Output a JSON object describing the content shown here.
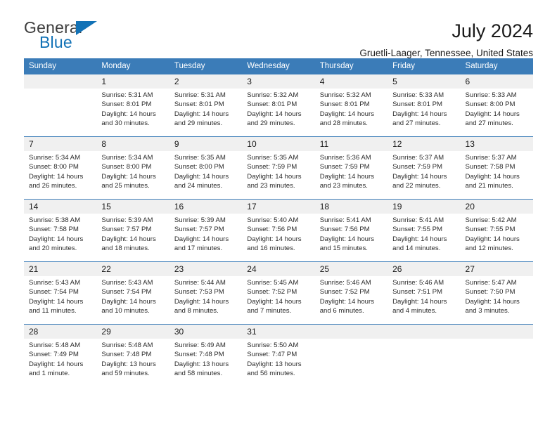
{
  "logo": {
    "word_one": "General",
    "word_two": "Blue",
    "triangle_icon": "triangle-icon",
    "accent_color": "#1272b6"
  },
  "header": {
    "title": "July 2024",
    "subtitle": "Gruetli-Laager, Tennessee, United States"
  },
  "calendar": {
    "header_color": "#3b7cb8",
    "daynum_band_color": "#f0f0f0",
    "weekdays": [
      "Sunday",
      "Monday",
      "Tuesday",
      "Wednesday",
      "Thursday",
      "Friday",
      "Saturday"
    ],
    "weeks": [
      [
        {
          "day": "",
          "lines": []
        },
        {
          "day": "1",
          "lines": [
            "Sunrise: 5:31 AM",
            "Sunset: 8:01 PM",
            "Daylight: 14 hours",
            "and 30 minutes."
          ]
        },
        {
          "day": "2",
          "lines": [
            "Sunrise: 5:31 AM",
            "Sunset: 8:01 PM",
            "Daylight: 14 hours",
            "and 29 minutes."
          ]
        },
        {
          "day": "3",
          "lines": [
            "Sunrise: 5:32 AM",
            "Sunset: 8:01 PM",
            "Daylight: 14 hours",
            "and 29 minutes."
          ]
        },
        {
          "day": "4",
          "lines": [
            "Sunrise: 5:32 AM",
            "Sunset: 8:01 PM",
            "Daylight: 14 hours",
            "and 28 minutes."
          ]
        },
        {
          "day": "5",
          "lines": [
            "Sunrise: 5:33 AM",
            "Sunset: 8:01 PM",
            "Daylight: 14 hours",
            "and 27 minutes."
          ]
        },
        {
          "day": "6",
          "lines": [
            "Sunrise: 5:33 AM",
            "Sunset: 8:00 PM",
            "Daylight: 14 hours",
            "and 27 minutes."
          ]
        }
      ],
      [
        {
          "day": "7",
          "lines": [
            "Sunrise: 5:34 AM",
            "Sunset: 8:00 PM",
            "Daylight: 14 hours",
            "and 26 minutes."
          ]
        },
        {
          "day": "8",
          "lines": [
            "Sunrise: 5:34 AM",
            "Sunset: 8:00 PM",
            "Daylight: 14 hours",
            "and 25 minutes."
          ]
        },
        {
          "day": "9",
          "lines": [
            "Sunrise: 5:35 AM",
            "Sunset: 8:00 PM",
            "Daylight: 14 hours",
            "and 24 minutes."
          ]
        },
        {
          "day": "10",
          "lines": [
            "Sunrise: 5:35 AM",
            "Sunset: 7:59 PM",
            "Daylight: 14 hours",
            "and 23 minutes."
          ]
        },
        {
          "day": "11",
          "lines": [
            "Sunrise: 5:36 AM",
            "Sunset: 7:59 PM",
            "Daylight: 14 hours",
            "and 23 minutes."
          ]
        },
        {
          "day": "12",
          "lines": [
            "Sunrise: 5:37 AM",
            "Sunset: 7:59 PM",
            "Daylight: 14 hours",
            "and 22 minutes."
          ]
        },
        {
          "day": "13",
          "lines": [
            "Sunrise: 5:37 AM",
            "Sunset: 7:58 PM",
            "Daylight: 14 hours",
            "and 21 minutes."
          ]
        }
      ],
      [
        {
          "day": "14",
          "lines": [
            "Sunrise: 5:38 AM",
            "Sunset: 7:58 PM",
            "Daylight: 14 hours",
            "and 20 minutes."
          ]
        },
        {
          "day": "15",
          "lines": [
            "Sunrise: 5:39 AM",
            "Sunset: 7:57 PM",
            "Daylight: 14 hours",
            "and 18 minutes."
          ]
        },
        {
          "day": "16",
          "lines": [
            "Sunrise: 5:39 AM",
            "Sunset: 7:57 PM",
            "Daylight: 14 hours",
            "and 17 minutes."
          ]
        },
        {
          "day": "17",
          "lines": [
            "Sunrise: 5:40 AM",
            "Sunset: 7:56 PM",
            "Daylight: 14 hours",
            "and 16 minutes."
          ]
        },
        {
          "day": "18",
          "lines": [
            "Sunrise: 5:41 AM",
            "Sunset: 7:56 PM",
            "Daylight: 14 hours",
            "and 15 minutes."
          ]
        },
        {
          "day": "19",
          "lines": [
            "Sunrise: 5:41 AM",
            "Sunset: 7:55 PM",
            "Daylight: 14 hours",
            "and 14 minutes."
          ]
        },
        {
          "day": "20",
          "lines": [
            "Sunrise: 5:42 AM",
            "Sunset: 7:55 PM",
            "Daylight: 14 hours",
            "and 12 minutes."
          ]
        }
      ],
      [
        {
          "day": "21",
          "lines": [
            "Sunrise: 5:43 AM",
            "Sunset: 7:54 PM",
            "Daylight: 14 hours",
            "and 11 minutes."
          ]
        },
        {
          "day": "22",
          "lines": [
            "Sunrise: 5:43 AM",
            "Sunset: 7:54 PM",
            "Daylight: 14 hours",
            "and 10 minutes."
          ]
        },
        {
          "day": "23",
          "lines": [
            "Sunrise: 5:44 AM",
            "Sunset: 7:53 PM",
            "Daylight: 14 hours",
            "and 8 minutes."
          ]
        },
        {
          "day": "24",
          "lines": [
            "Sunrise: 5:45 AM",
            "Sunset: 7:52 PM",
            "Daylight: 14 hours",
            "and 7 minutes."
          ]
        },
        {
          "day": "25",
          "lines": [
            "Sunrise: 5:46 AM",
            "Sunset: 7:52 PM",
            "Daylight: 14 hours",
            "and 6 minutes."
          ]
        },
        {
          "day": "26",
          "lines": [
            "Sunrise: 5:46 AM",
            "Sunset: 7:51 PM",
            "Daylight: 14 hours",
            "and 4 minutes."
          ]
        },
        {
          "day": "27",
          "lines": [
            "Sunrise: 5:47 AM",
            "Sunset: 7:50 PM",
            "Daylight: 14 hours",
            "and 3 minutes."
          ]
        }
      ],
      [
        {
          "day": "28",
          "lines": [
            "Sunrise: 5:48 AM",
            "Sunset: 7:49 PM",
            "Daylight: 14 hours",
            "and 1 minute."
          ]
        },
        {
          "day": "29",
          "lines": [
            "Sunrise: 5:48 AM",
            "Sunset: 7:48 PM",
            "Daylight: 13 hours",
            "and 59 minutes."
          ]
        },
        {
          "day": "30",
          "lines": [
            "Sunrise: 5:49 AM",
            "Sunset: 7:48 PM",
            "Daylight: 13 hours",
            "and 58 minutes."
          ]
        },
        {
          "day": "31",
          "lines": [
            "Sunrise: 5:50 AM",
            "Sunset: 7:47 PM",
            "Daylight: 13 hours",
            "and 56 minutes."
          ]
        },
        {
          "day": "",
          "lines": []
        },
        {
          "day": "",
          "lines": []
        },
        {
          "day": "",
          "lines": []
        }
      ]
    ]
  }
}
